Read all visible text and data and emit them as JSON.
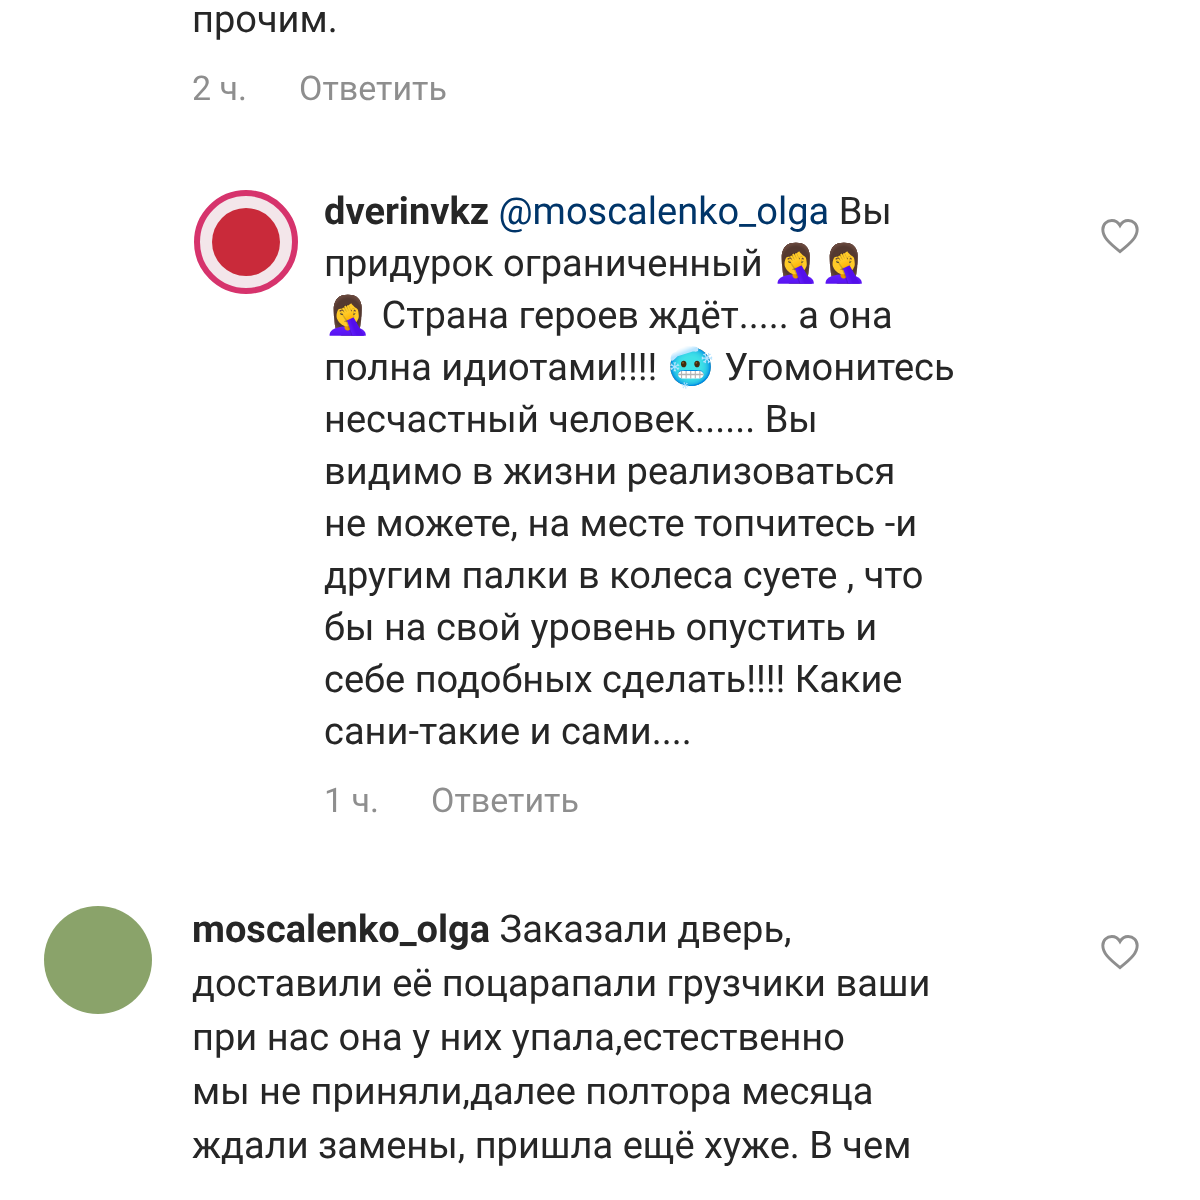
{
  "partial_comment": {
    "text": "прочим.",
    "time": "2 ч.",
    "reply": "Ответить"
  },
  "comments": [
    {
      "kind": "logo",
      "username": "dverinvkz",
      "mention": "@moscalenko_olga",
      "text": "Вы\nпридурок ограниченный 🤦‍♀️🤦‍♀️\n🤦‍♀️ Страна героев ждёт..... а она\nполна идиотами!!!! 🥶 Угомонитесь\nнесчастный человек...... Вы\nвидимо в жизни реализоваться\nне можете, на месте топчитесь -и\nдругим палки в колеса суете , что\nбы на свой уровень опустить и\nсебе подобных сделать!!!! Какие\nсани-такие и сами....",
      "time": "1 ч.",
      "reply": "Ответить",
      "liked": false
    },
    {
      "kind": "photo",
      "username": "moscalenko_olga",
      "text": "Заказали дверь,\nдоставили её поцарапали грузчики ваши\nпри нас она у них упала,естественно\nмы не приняли,далее полтора месяца\nждали замены, пришла ещё хуже. В чем",
      "liked": false
    }
  ]
}
